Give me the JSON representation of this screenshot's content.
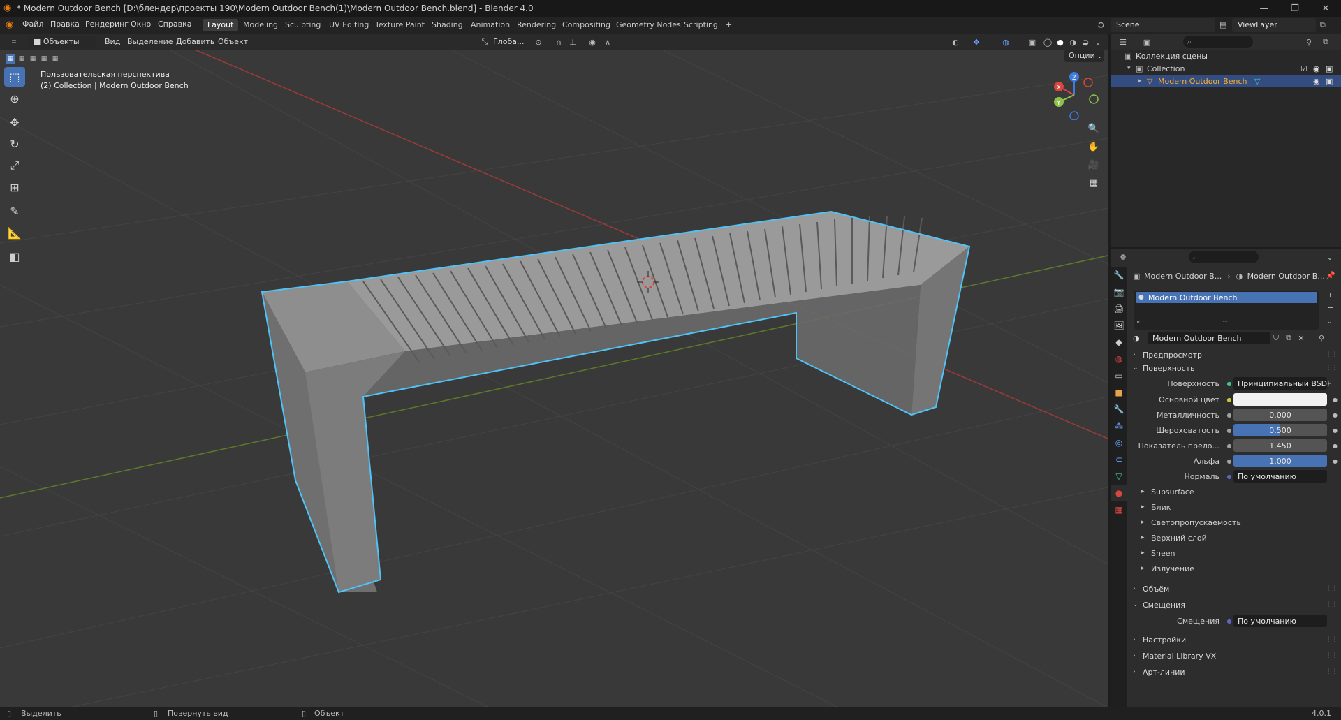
{
  "window": {
    "title": "* Modern Outdoor Bench [D:\\блендер\\проекты 190\\Modern Outdoor Bench(1)\\Modern Outdoor Bench.blend] - Blender 4.0",
    "minimize": "—",
    "maximize": "❐",
    "close": "✕"
  },
  "menu": [
    "Файл",
    "Правка",
    "Рендеринг",
    "Окно",
    "Справка"
  ],
  "workspaces": [
    "Layout",
    "Modeling",
    "Sculpting",
    "UV Editing",
    "Texture Paint",
    "Shading",
    "Animation",
    "Rendering",
    "Compositing",
    "Geometry Nodes",
    "Scripting"
  ],
  "workspace_add": "+",
  "scene": {
    "name": "Scene",
    "viewlayer": "ViewLayer"
  },
  "viewport_header": {
    "mode": "Объекты",
    "items": [
      "Вид",
      "Выделение",
      "Добавить",
      "Объект"
    ],
    "transform": "Глоба...",
    "options": "Опции"
  },
  "viewport": {
    "perspective": "Пользовательская перспектива",
    "collection_info": "(2) Collection | Modern Outdoor Bench"
  },
  "gizmo": {
    "x": "X",
    "y": "Y",
    "z": "Z"
  },
  "outliner": {
    "root": "Коллекция сцены",
    "collection": "Collection",
    "object": "Modern Outdoor Bench"
  },
  "properties": {
    "breadcrumb_object": "Modern Outdoor B...",
    "breadcrumb_material": "Modern Outdoor B...",
    "slot": "Modern Outdoor Bench",
    "material_name": "Modern Outdoor Bench",
    "sections": {
      "preview": "Предпросмотр",
      "surface": "Поверхность",
      "volume": "Объём",
      "displacement": "Смещения",
      "settings": "Настройки",
      "material_library": "Material Library VX",
      "lineart": "Арт-линии"
    },
    "surface_fields": [
      {
        "label": "Поверхность",
        "value": "Принципиальный BSDF",
        "style": "dark",
        "dot": "green"
      },
      {
        "label": "Основной цвет",
        "value": "",
        "style": "white",
        "dot": "yellow"
      },
      {
        "label": "Металличность",
        "value": "0.000",
        "style": "grey",
        "dot": "grey"
      },
      {
        "label": "Шероховатость",
        "value": "0.500",
        "style": "blue",
        "dot": "grey"
      },
      {
        "label": "Показатель прело...",
        "value": "1.450",
        "style": "grey",
        "dot": "grey"
      },
      {
        "label": "Альфа",
        "value": "1.000",
        "style": "blue",
        "dot": "grey"
      },
      {
        "label": "Нормаль",
        "value": "По умолчанию",
        "style": "dark",
        "dot": "blue"
      }
    ],
    "subpanels": [
      "Subsurface",
      "Блик",
      "Светопропускаемость",
      "Верхний слой",
      "Sheen",
      "Излучение"
    ],
    "displacement_field": {
      "label": "Смещения",
      "value": "По умолчанию"
    }
  },
  "statusbar": {
    "select": "Выделить",
    "rotate": "Повернуть вид",
    "object": "Объект",
    "version": "4.0.1"
  },
  "colors": {
    "accent": "#4772b3",
    "selection_outline": "#4fc3f7",
    "x_axis": "#d9453f",
    "y_axis": "#8bc34a",
    "z_axis": "#3d7be0",
    "bench": "#8a8a8a"
  }
}
